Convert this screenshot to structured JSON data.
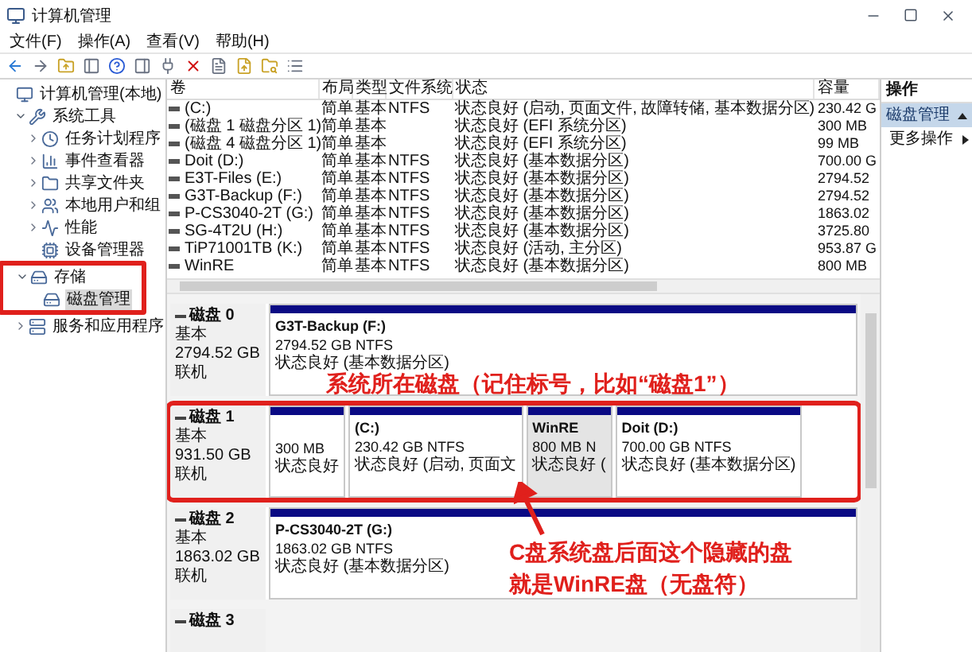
{
  "window": {
    "title": "计算机管理"
  },
  "menu": [
    "文件(F)",
    "操作(A)",
    "查看(V)",
    "帮助(H)"
  ],
  "tree": [
    {
      "label": "计算机管理(本地)",
      "selected": false,
      "highlighted": false,
      "children": [
        {
          "label": "系统工具",
          "expanded": true,
          "selected": false,
          "highlighted": false,
          "children": [
            {
              "label": "任务计划程序",
              "expanded": false,
              "selected": false,
              "highlighted": false
            },
            {
              "label": "事件查看器",
              "expanded": false,
              "selected": false,
              "highlighted": false
            },
            {
              "label": "共享文件夹",
              "expanded": false,
              "selected": false,
              "highlighted": false
            },
            {
              "label": "本地用户和组",
              "expanded": false,
              "selected": false,
              "highlighted": false
            },
            {
              "label": "性能",
              "expanded": false,
              "selected": false,
              "highlighted": false
            },
            {
              "label": "设备管理器",
              "selected": false,
              "highlighted": false
            }
          ]
        },
        {
          "label": "存储",
          "expanded": true,
          "selected": false,
          "highlighted": true,
          "children": [
            {
              "label": "磁盘管理",
              "selected": true,
              "highlighted": false
            }
          ]
        },
        {
          "label": "服务和应用程序",
          "expanded": false,
          "selected": false,
          "highlighted": false
        }
      ]
    }
  ],
  "table": {
    "columns": [
      "卷",
      "布局",
      "类型",
      "文件系统",
      "状态",
      "容量"
    ],
    "rows": [
      {
        "volume": "(C:)",
        "layout": "简单",
        "type": "基本",
        "filesystem": "NTFS",
        "status": "状态良好 (启动, 页面文件, 故障转储, 基本数据分区)",
        "capacity": "230.42 G"
      },
      {
        "volume": "(磁盘 1 磁盘分区 1)",
        "layout": "简单",
        "type": "基本",
        "status": "状态良好 (EFI 系统分区)",
        "capacity": "300 MB"
      },
      {
        "volume": "(磁盘 4 磁盘分区 1)",
        "layout": "简单",
        "type": "基本",
        "status": "状态良好 (EFI 系统分区)",
        "capacity": "99 MB"
      },
      {
        "volume": "Doit (D:)",
        "layout": "简单",
        "type": "基本",
        "filesystem": "NTFS",
        "status": "状态良好 (基本数据分区)",
        "capacity": "700.00 G"
      },
      {
        "volume": "E3T-Files (E:)",
        "layout": "简单",
        "type": "基本",
        "filesystem": "NTFS",
        "status": "状态良好 (基本数据分区)",
        "capacity": "2794.52"
      },
      {
        "volume": "G3T-Backup (F:)",
        "layout": "简单",
        "type": "基本",
        "filesystem": "NTFS",
        "status": "状态良好 (基本数据分区)",
        "capacity": "2794.52"
      },
      {
        "volume": "P-CS3040-2T (G:)",
        "layout": "简单",
        "type": "基本",
        "filesystem": "NTFS",
        "status": "状态良好 (基本数据分区)",
        "capacity": "1863.02"
      },
      {
        "volume": "SG-4T2U (H:)",
        "layout": "简单",
        "type": "基本",
        "filesystem": "NTFS",
        "status": "状态良好 (基本数据分区)",
        "capacity": "3725.80"
      },
      {
        "volume": "TiP71001TB (K:)",
        "layout": "简单",
        "type": "基本",
        "filesystem": "NTFS",
        "status": "状态良好 (活动, 主分区)",
        "capacity": "953.87 G"
      },
      {
        "volume": "WinRE",
        "layout": "简单",
        "type": "基本",
        "filesystem": "NTFS",
        "status": "状态良好 (基本数据分区)",
        "capacity": "800 MB"
      }
    ]
  },
  "disks": [
    {
      "name": "磁盘 0",
      "type": "基本",
      "size": "2794.52 GB",
      "state": "联机",
      "highlighted": false,
      "partitions": [
        {
          "name": "G3T-Backup  (F:)",
          "size": "2794.52 GB NTFS",
          "status": "状态良好 (基本数据分区)",
          "selected": false
        }
      ]
    },
    {
      "name": "磁盘 1",
      "type": "基本",
      "size": "931.50 GB",
      "state": "联机",
      "highlighted": true,
      "partitions": [
        {
          "size": "300 MB",
          "status": "状态良好",
          "selected": false
        },
        {
          "name": "(C:)",
          "size": "230.42 GB NTFS",
          "status": "状态良好 (启动, 页面文",
          "selected": false
        },
        {
          "name": "WinRE",
          "size": "800 MB N",
          "status": "状态良好 (",
          "selected": true
        },
        {
          "name": "Doit  (D:)",
          "size": "700.00 GB NTFS",
          "status": "状态良好 (基本数据分区)",
          "selected": false
        }
      ]
    },
    {
      "name": "磁盘 2",
      "type": "基本",
      "size": "1863.02 GB",
      "state": "联机",
      "highlighted": false,
      "partitions": [
        {
          "name": "P-CS3040-2T  (G:)",
          "size": "1863.02 GB NTFS",
          "status": "状态良好 (基本数据分区)",
          "selected": false
        }
      ]
    },
    {
      "name": "磁盘 3",
      "highlighted": false
    }
  ],
  "actions": {
    "title": "操作",
    "section": "磁盘管理",
    "items": [
      "更多操作"
    ]
  },
  "annotations": {
    "disk_note": "系统所在磁盘（记住标号，比如“磁盘1”）",
    "callout": [
      "C盘系统盘后面这个隐藏的盘",
      "就是WinRE盘（无盘符）"
    ]
  }
}
